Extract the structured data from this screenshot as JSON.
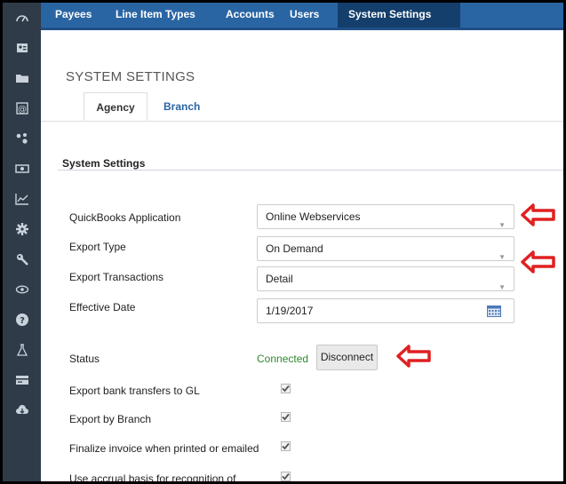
{
  "sidebar": {
    "icons": [
      "dashboard-icon",
      "id-card-icon",
      "folder-icon",
      "at-sign-icon",
      "network-icon",
      "money-icon",
      "chart-icon",
      "gear-icon",
      "wrench-icon",
      "eye-icon",
      "help-icon",
      "flask-icon",
      "card-icon",
      "cloud-icon"
    ]
  },
  "topnav": {
    "tabs": [
      {
        "label": "Payees",
        "active": false
      },
      {
        "label": "Line Item Types",
        "active": false
      },
      {
        "label": "Accounts",
        "active": false
      },
      {
        "label": "Users",
        "active": false
      },
      {
        "label": "System Settings",
        "active": true
      }
    ]
  },
  "page": {
    "title": "SYSTEM SETTINGS",
    "subtabs": [
      {
        "label": "Agency",
        "active": true
      },
      {
        "label": "Branch",
        "active": false
      }
    ],
    "section_title": "System Settings"
  },
  "form": {
    "quickbooks_application": {
      "label": "QuickBooks Application",
      "value": "Online Webservices"
    },
    "export_type": {
      "label": "Export Type",
      "value": "On Demand"
    },
    "export_transactions": {
      "label": "Export Transactions",
      "value": "Detail"
    },
    "effective_date": {
      "label": "Effective Date",
      "value": "1/19/2017"
    },
    "status": {
      "label": "Status",
      "value": "Connected",
      "button": "Disconnect"
    },
    "checkboxes": [
      {
        "label": "Export bank transfers to GL",
        "checked": true
      },
      {
        "label": "Export by Branch",
        "checked": true
      },
      {
        "label": "Finalize invoice when printed or emailed",
        "checked": true
      },
      {
        "label": "Use accrual basis for recognition of",
        "checked": true
      }
    ]
  },
  "colors": {
    "nav_blue": "#2a65a3",
    "nav_active": "#143e6c",
    "sidebar": "#2f3b48",
    "connected_green": "#2e8a2e",
    "annotation_arrow": "#e02020"
  }
}
